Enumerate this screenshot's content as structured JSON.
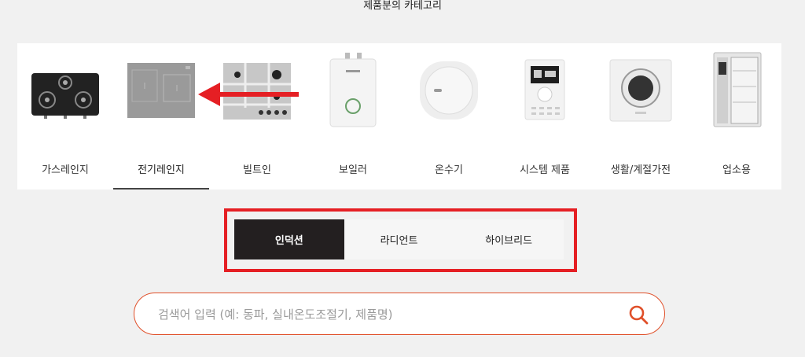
{
  "section_title": "제품분의 카테고리",
  "categories": [
    {
      "label": "가스레인지",
      "icon": "gas-range-icon"
    },
    {
      "label": "전기레인지",
      "icon": "electric-range-icon",
      "active": true
    },
    {
      "label": "빌트인",
      "icon": "built-in-icon"
    },
    {
      "label": "보일러",
      "icon": "boiler-icon"
    },
    {
      "label": "온수기",
      "icon": "water-heater-icon"
    },
    {
      "label": "시스템 제품",
      "icon": "system-controller-icon"
    },
    {
      "label": "생활/계절가전",
      "icon": "dryer-icon"
    },
    {
      "label": "업소용",
      "icon": "commercial-oven-icon"
    }
  ],
  "sub_tabs": [
    {
      "label": "인덕션",
      "active": true
    },
    {
      "label": "라디언트"
    },
    {
      "label": "하이브리드"
    }
  ],
  "search": {
    "placeholder": "검색어 입력 (예: 동파, 실내온도조절기, 제품명)",
    "value": ""
  },
  "colors": {
    "accent": "#e0502a",
    "highlight_frame": "#e51f24",
    "active_tab": "#231f20"
  }
}
